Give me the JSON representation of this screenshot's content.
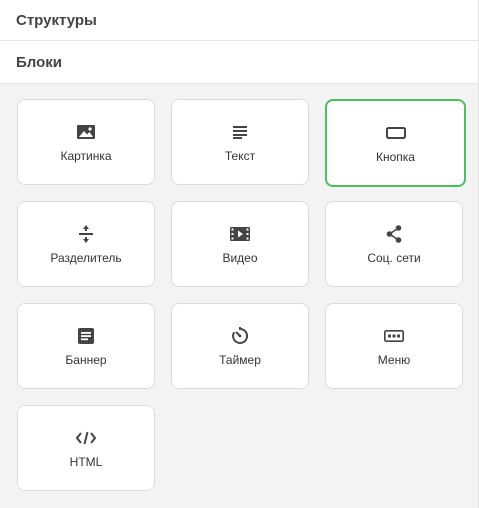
{
  "sections": {
    "structures_title": "Структуры",
    "blocks_title": "Блоки"
  },
  "blocks": [
    {
      "label": "Картинка",
      "icon": "image-icon"
    },
    {
      "label": "Текст",
      "icon": "text-lines-icon"
    },
    {
      "label": "Кнопка",
      "icon": "button-icon",
      "selected": true
    },
    {
      "label": "Разделитель",
      "icon": "divider-icon"
    },
    {
      "label": "Видео",
      "icon": "video-icon"
    },
    {
      "label": "Соц. сети",
      "icon": "share-icon"
    },
    {
      "label": "Баннер",
      "icon": "banner-icon"
    },
    {
      "label": "Таймер",
      "icon": "timer-icon"
    },
    {
      "label": "Меню",
      "icon": "menu-icon"
    },
    {
      "label": "HTML",
      "icon": "code-icon"
    }
  ],
  "colors": {
    "selected_border": "#4bbf5a",
    "icon": "#444444",
    "area_background": "#f3f3f3"
  }
}
